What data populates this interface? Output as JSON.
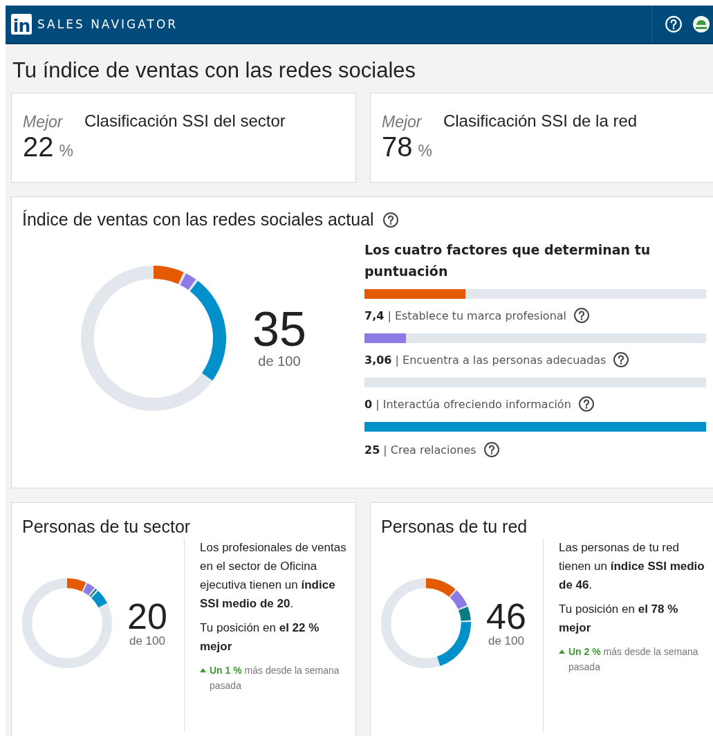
{
  "header": {
    "logo": "in",
    "brand": "SALES NAVIGATOR"
  },
  "page_title": "Tu índice de ventas con las redes sociales",
  "rankings": [
    {
      "qualifier": "Mejor",
      "value": "22",
      "unit": "%",
      "title": "Clasificación SSI del sector"
    },
    {
      "qualifier": "Mejor",
      "value": "78",
      "unit": "%",
      "title": "Clasificación SSI de la red"
    }
  ],
  "current": {
    "title": "Índice de ventas con las redes sociales actual",
    "score": "35",
    "out_of": "de 100",
    "donut": [
      {
        "color": "#e35a00"
      },
      {
        "color": "#8c7ae6"
      },
      {
        "color": "#0091ca"
      }
    ],
    "factors_title": "Los cuatro factores que determinan tu puntuación",
    "factors": [
      {
        "score": "7,4",
        "separator": "|",
        "label": "Establece tu marca profesional",
        "level": 0.296,
        "color": "#e35a00"
      },
      {
        "score": "3,06",
        "separator": "|",
        "label": "Encuentra a las personas adecuadas",
        "level": 0.122,
        "color": "#8c7ae6"
      },
      {
        "score": "0",
        "separator": "|",
        "label": "Interactúa ofreciendo información"
      },
      {
        "score": "25",
        "separator": "|",
        "label": "Crea relaciones",
        "level": 1,
        "color": "#0091ca"
      }
    ]
  },
  "peers": [
    {
      "title": "Personas de tu sector",
      "score": "20",
      "out_of": "de 100",
      "donut": [
        {
          "color": "#e35a00"
        },
        {
          "color": "#8c7ae6"
        },
        {
          "color": "#0a7a84"
        },
        {
          "color": "#0091ca"
        }
      ],
      "text": "Los profesionales de ventas en el sector de Oficina ejecutiva tienen un **índice SSI medio de 20**.",
      "position": "Tu posición en **el 22 % mejor**",
      "change": "**Un 1 %** más desde la semana pasada"
    },
    {
      "title": "Personas de tu red",
      "score": "46",
      "out_of": "de 100",
      "donut": [
        {
          "color": "#e35a00"
        },
        {
          "color": "#8c7ae6"
        },
        {
          "color": "#0a7a84"
        },
        {
          "color": "#0091ca"
        }
      ],
      "text": "Las personas de tu red tienen un **índice SSI medio de 46**.",
      "position": "Tu posición en **el 78 % mejor**",
      "change": "**Un 2 %** más desde la semana pasada"
    }
  ]
}
